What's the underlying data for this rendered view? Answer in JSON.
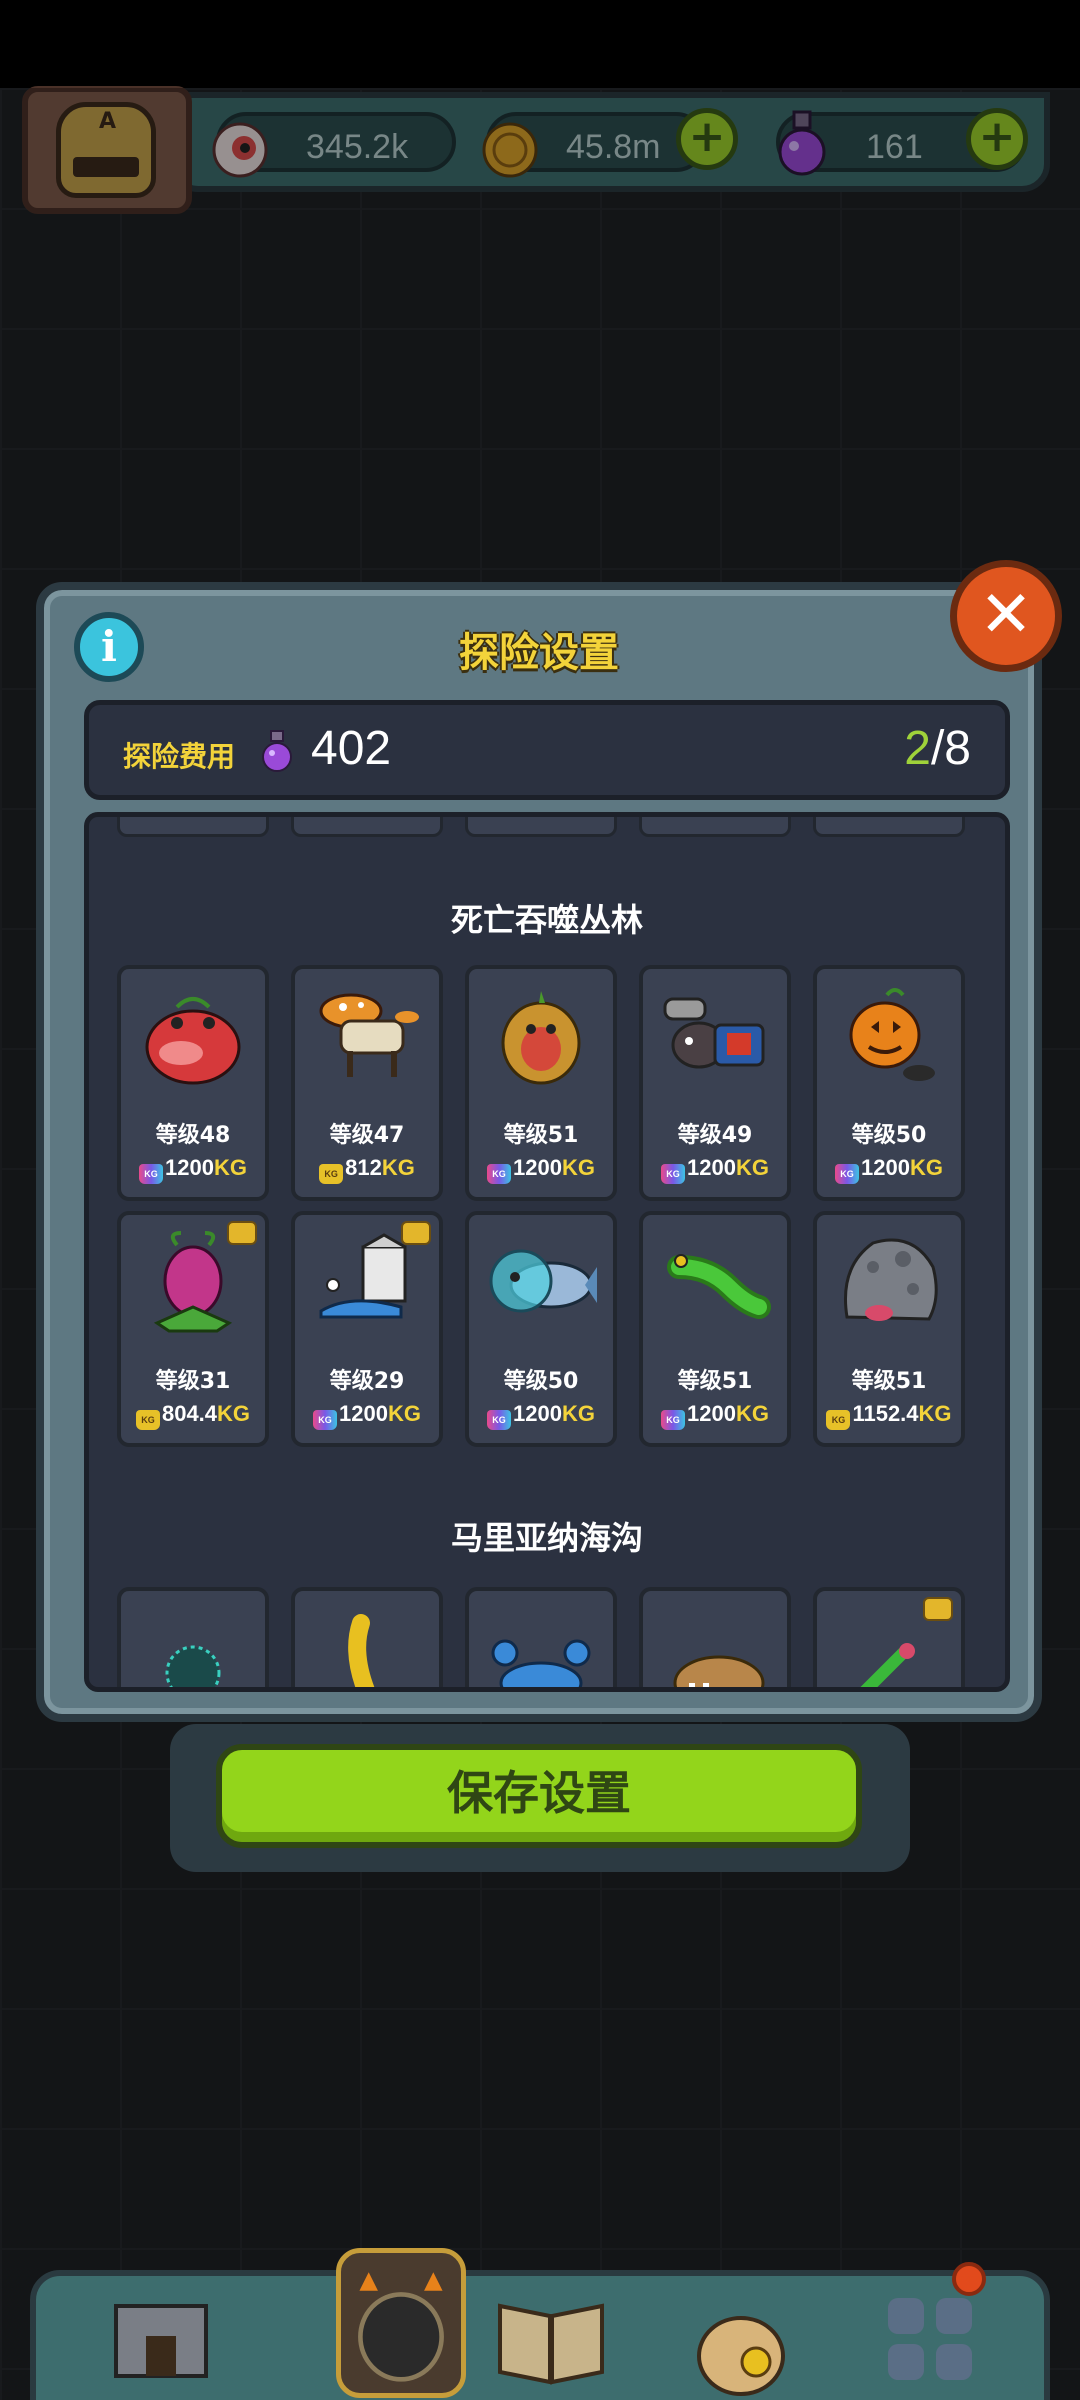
{
  "resources": {
    "eyes": "345.2k",
    "coins": "45.8m",
    "potions": "161"
  },
  "modal": {
    "title": "探险设置",
    "cost_label": "探险费用",
    "cost_value": "402",
    "count_current": "2",
    "count_sep": "/",
    "count_max": "8",
    "close_symbol": "✕",
    "info_symbol": "i"
  },
  "sections": [
    {
      "title": "死亡吞噬丛林",
      "creatures": [
        {
          "level": "等级48",
          "weight": "1200",
          "unit": "KG",
          "icon": "red-toad"
        },
        {
          "level": "等级47",
          "weight": "812",
          "unit": "KG",
          "icon": "mushroom-goat"
        },
        {
          "level": "等级51",
          "weight": "1200",
          "unit": "KG",
          "icon": "tiki-monkey"
        },
        {
          "level": "等级49",
          "weight": "1200",
          "unit": "KG",
          "icon": "chainsaw-boar"
        },
        {
          "level": "等级50",
          "weight": "1200",
          "unit": "KG",
          "icon": "pumpkin-cat"
        },
        {
          "level": "等级31",
          "weight": "804.4",
          "unit": "KG",
          "icon": "pink-plant"
        },
        {
          "level": "等级29",
          "weight": "1200",
          "unit": "KG",
          "icon": "milk-snail"
        },
        {
          "level": "等级50",
          "weight": "1200",
          "unit": "KG",
          "icon": "bubble-fish"
        },
        {
          "level": "等级51",
          "weight": "1200",
          "unit": "KG",
          "icon": "green-caterpillar"
        },
        {
          "level": "等级51",
          "weight": "1152.4",
          "unit": "KG",
          "icon": "rock-monster"
        }
      ]
    },
    {
      "title": "马里亚纳海沟",
      "creatures": [
        {
          "icon": "sea-urchin"
        },
        {
          "icon": "banana-squid"
        },
        {
          "icon": "blue-crab"
        },
        {
          "icon": "walrus"
        },
        {
          "icon": "mantis"
        }
      ]
    }
  ],
  "save_button": "保存设置",
  "colors": {
    "accent_yellow": "#f3d33a",
    "accent_green": "#93d51b",
    "close_orange": "#e0561f",
    "info_cyan": "#3bc4dd"
  }
}
